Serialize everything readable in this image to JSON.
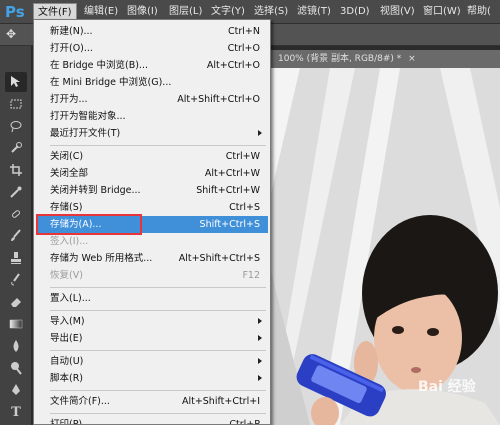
{
  "app_logo": "Ps",
  "menubar": {
    "items": [
      "文件(F)",
      "编辑(E)",
      "图像(I)",
      "图层(L)",
      "文字(Y)",
      "选择(S)",
      "滤镜(T)",
      "3D(D)",
      "视图(V)",
      "窗口(W)",
      "帮助("
    ]
  },
  "document_tab": {
    "title": "100% (背景 副本, RGB/8#) *",
    "close": "×"
  },
  "file_menu": {
    "items": [
      {
        "label": "新建(N)...",
        "shortcut": "Ctrl+N"
      },
      {
        "label": "打开(O)...",
        "shortcut": "Ctrl+O"
      },
      {
        "label": "在 Bridge 中浏览(B)...",
        "shortcut": "Alt+Ctrl+O"
      },
      {
        "label": "在 Mini Bridge 中浏览(G)...",
        "shortcut": ""
      },
      {
        "label": "打开为...",
        "shortcut": "Alt+Shift+Ctrl+O"
      },
      {
        "label": "打开为智能对象...",
        "shortcut": ""
      },
      {
        "label": "最近打开文件(T)",
        "shortcut": ""
      },
      {
        "label": "关闭(C)",
        "shortcut": "Ctrl+W"
      },
      {
        "label": "关闭全部",
        "shortcut": "Alt+Ctrl+W"
      },
      {
        "label": "关闭并转到 Bridge...",
        "shortcut": "Shift+Ctrl+W"
      },
      {
        "label": "存储(S)",
        "shortcut": "Ctrl+S"
      },
      {
        "label": "存储为(A)...",
        "shortcut": "Shift+Ctrl+S"
      },
      {
        "label": "签入(I)...",
        "shortcut": ""
      },
      {
        "label": "存储为 Web 所用格式...",
        "shortcut": "Alt+Shift+Ctrl+S"
      },
      {
        "label": "恢复(V)",
        "shortcut": "F12"
      },
      {
        "label": "置入(L)...",
        "shortcut": ""
      },
      {
        "label": "导入(M)",
        "shortcut": ""
      },
      {
        "label": "导出(E)",
        "shortcut": ""
      },
      {
        "label": "自动(U)",
        "shortcut": ""
      },
      {
        "label": "脚本(R)",
        "shortcut": ""
      },
      {
        "label": "文件简介(F)...",
        "shortcut": "Alt+Shift+Ctrl+I"
      },
      {
        "label": "打印(P)...",
        "shortcut": "Ctrl+P"
      }
    ]
  },
  "watermark": {
    "text": "Bai 经验"
  },
  "colors": {
    "highlight": "#3f8fd9",
    "annotation": "#e8353a",
    "ps_blue": "#43a3e8"
  }
}
